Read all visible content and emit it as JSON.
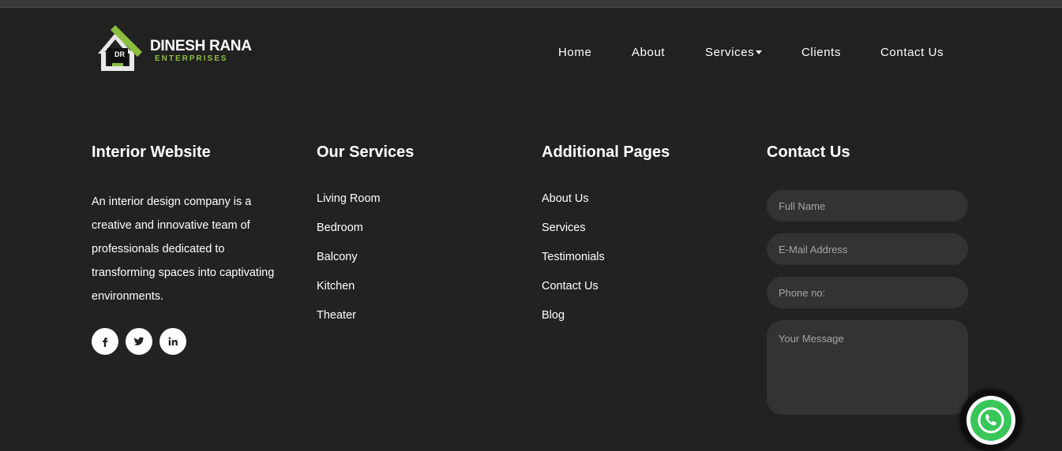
{
  "brand": {
    "name": "DINESH RANA",
    "subtitle": "ENTERPRISES",
    "initials": "DR",
    "accent_color": "#8cbf3f"
  },
  "nav": {
    "items": [
      {
        "label": "Home"
      },
      {
        "label": "About"
      },
      {
        "label": "Services"
      },
      {
        "label": "Clients"
      },
      {
        "label": "Contact Us"
      }
    ]
  },
  "footer": {
    "about": {
      "heading": "Interior Website",
      "text": "An interior design company is a creative and innovative team of professionals dedicated to transforming spaces into captivating environments.",
      "social": [
        "facebook-icon",
        "twitter-icon",
        "linkedin-icon"
      ]
    },
    "services": {
      "heading": "Our Services",
      "links": [
        "Living Room",
        "Bedroom",
        "Balcony",
        "Kitchen",
        "Theater"
      ]
    },
    "pages": {
      "heading": "Additional Pages",
      "links": [
        "About Us",
        "Services",
        "Testimonials",
        "Contact Us",
        "Blog"
      ]
    },
    "contact": {
      "heading": "Contact Us",
      "form": {
        "name_placeholder": "Full Name",
        "email_placeholder": "E-Mail Address",
        "phone_placeholder": "Phone no:",
        "message_placeholder": "Your Message"
      }
    }
  },
  "colors": {
    "background": "#222222",
    "field_background": "#333333",
    "whatsapp_green": "#39c659"
  }
}
